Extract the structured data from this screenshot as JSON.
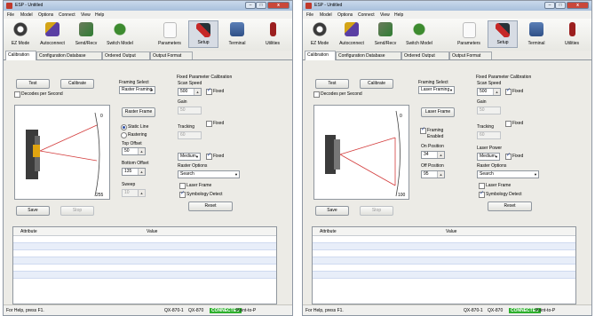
{
  "colors": {
    "connected": "#2db02d",
    "beam": "#d33b3b",
    "title_bar": "#b8cce4"
  },
  "windows": [
    {
      "title": "ESP - Untitled",
      "menu": [
        "File",
        "Model",
        "Options",
        "Connect",
        "View",
        "Help"
      ],
      "toolbar": [
        {
          "label": "EZ Mode",
          "icon": "ez-mode-icon"
        },
        {
          "label": "Autoconnect",
          "icon": "autoconnect-icon"
        },
        {
          "label": "Send/Recv",
          "icon": "send-recv-icon"
        },
        {
          "label": "Switch Model",
          "icon": "switch-model-icon"
        },
        {
          "label": "Parameters",
          "icon": "parameters-icon"
        },
        {
          "label": "Setup",
          "icon": "setup-icon",
          "active": true
        },
        {
          "label": "Terminal",
          "icon": "terminal-icon"
        },
        {
          "label": "Utilities",
          "icon": "utilities-icon"
        }
      ],
      "tabs": [
        "Calibration",
        "Configuration Database",
        "Ordered Output",
        "Output Format"
      ],
      "test_label": "Test",
      "calibrate_label": "Calibrate",
      "decodes_label": "Decodes per Second",
      "save_label": "Save",
      "stop_label": "Stop",
      "scale_top": "0",
      "scale_bottom": "255",
      "framing_select_label": "Framing Select",
      "framing_select_value": "Raster Framing",
      "raster_frame_label": "Raster Frame",
      "static_line_label": "Static Line",
      "rastering_label": "Rastering",
      "top_offset_label": "Top Offset",
      "top_offset_value": "50",
      "bottom_offset_label": "Bottom Offset",
      "bottom_offset_value": "135",
      "sweep_label": "Sweep",
      "sweep_value": "10",
      "fixed_title": "Fixed Parameter Calibration",
      "scan_speed_label": "Scan Speed",
      "scan_speed_value": "500",
      "fixed_label": "Fixed",
      "gain_label": "Gain",
      "gain_value": "50",
      "tracking_label": "Tracking",
      "tracking_value": "60",
      "laser_power_label": "",
      "laser_power_value": "Medium",
      "raster_options_label": "Raster Options",
      "raster_options_value": "Search",
      "laser_frame_label": "Laser Frame",
      "symbology_detect_label": "Symbology Detect",
      "reset_label": "Reset",
      "grid_headers": [
        "Attribute",
        "Value"
      ],
      "status": {
        "help": "For Help, press F1.",
        "model": "QX-870-1",
        "model2": "QX-870",
        "conn": "CONNECTED",
        "mode": "Point-to-P"
      }
    },
    {
      "title": "ESP - Untitled",
      "menu": [
        "File",
        "Model",
        "Options",
        "Connect",
        "View",
        "Help"
      ],
      "toolbar": [
        {
          "label": "EZ Mode",
          "icon": "ez-mode-icon"
        },
        {
          "label": "Autoconnect",
          "icon": "autoconnect-icon"
        },
        {
          "label": "Send/Recv",
          "icon": "send-recv-icon"
        },
        {
          "label": "Switch Model",
          "icon": "switch-model-icon"
        },
        {
          "label": "Parameters",
          "icon": "parameters-icon"
        },
        {
          "label": "Setup",
          "icon": "setup-icon",
          "active": true
        },
        {
          "label": "Terminal",
          "icon": "terminal-icon"
        },
        {
          "label": "Utilities",
          "icon": "utilities-icon"
        }
      ],
      "tabs": [
        "Calibration",
        "Configuration Database",
        "Ordered Output",
        "Output Format"
      ],
      "test_label": "Test",
      "calibrate_label": "Calibrate",
      "decodes_label": "Decodes per Second",
      "save_label": "Save",
      "stop_label": "Stop",
      "scale_top": "0",
      "scale_bottom": "100",
      "framing_select_label": "Framing Select",
      "framing_select_value": "Laser Framing",
      "laser_frame_btn_label": "Laser Frame",
      "framing_enabled_label": "Framing Enabled",
      "on_position_label": "On Position",
      "on_position_value": "34",
      "off_position_label": "Off Position",
      "off_position_value": "95",
      "fixed_title": "Fixed Parameter Calibration",
      "scan_speed_label": "Scan Speed",
      "scan_speed_value": "500",
      "fixed_label": "Fixed",
      "gain_label": "Gain",
      "gain_value": "50",
      "tracking_label": "Tracking",
      "tracking_value": "60",
      "laser_power_label": "Laser Power",
      "laser_power_value": "Medium",
      "raster_options_label": "Raster Options",
      "raster_options_value": "Search",
      "laser_frame_label": "Laser Frame",
      "symbology_detect_label": "Symbology Detect",
      "reset_label": "Reset",
      "grid_headers": [
        "Attribute",
        "Value"
      ],
      "status": {
        "help": "For Help, press F1.",
        "model": "QX-870-1",
        "model2": "QX-870",
        "conn": "CONNECTED",
        "mode": "Point-to-P"
      }
    }
  ]
}
